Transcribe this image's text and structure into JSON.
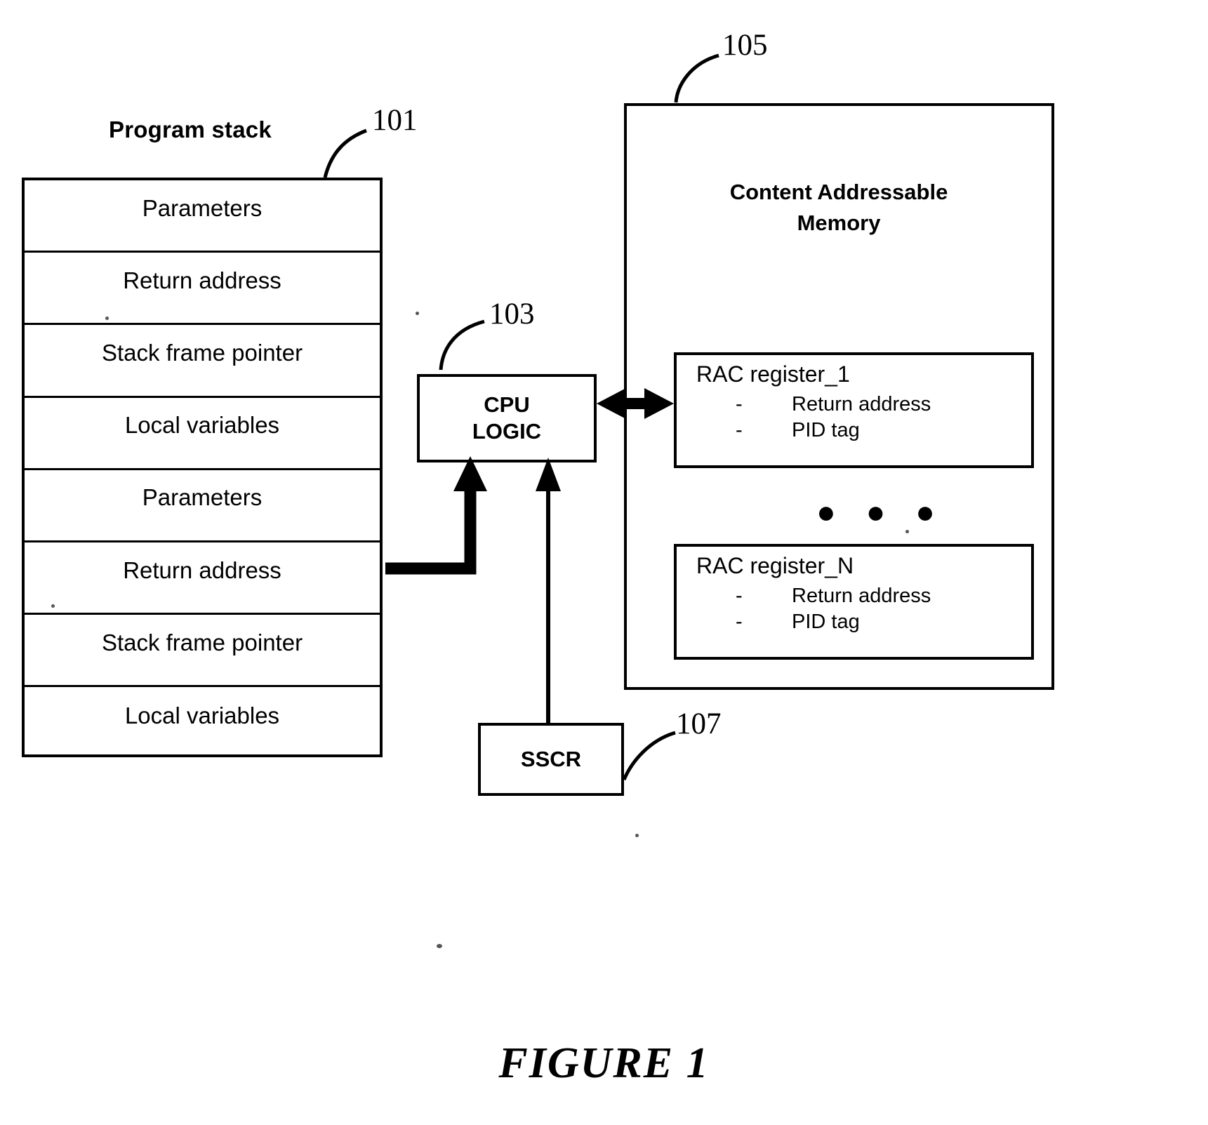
{
  "figure": {
    "caption": "FIGURE 1"
  },
  "program_stack": {
    "title": "Program stack",
    "ref": "101",
    "rows": [
      {
        "label": "Parameters"
      },
      {
        "label": "Return address"
      },
      {
        "label": "Stack frame pointer"
      },
      {
        "label": "Local variables"
      },
      {
        "label": "Parameters"
      },
      {
        "label": "Return address"
      },
      {
        "label": "Stack frame pointer"
      },
      {
        "label": "Local variables"
      }
    ]
  },
  "cpu_logic": {
    "line1": "CPU",
    "line2": "LOGIC",
    "ref": "103"
  },
  "content_addressable_memory": {
    "title_line1": "Content Addressable",
    "title_line2": "Memory",
    "ref": "105",
    "ellipsis": "● ● ●",
    "registers": [
      {
        "name": "RAC register_1",
        "bullet": "-",
        "items": [
          "Return address",
          "PID tag"
        ]
      },
      {
        "name": "RAC register_N",
        "bullet": "-",
        "items": [
          "Return address",
          "PID tag"
        ]
      }
    ]
  },
  "sscr": {
    "label": "SSCR",
    "ref": "107"
  },
  "colors": {
    "stroke": "#000000",
    "background": "#ffffff"
  }
}
